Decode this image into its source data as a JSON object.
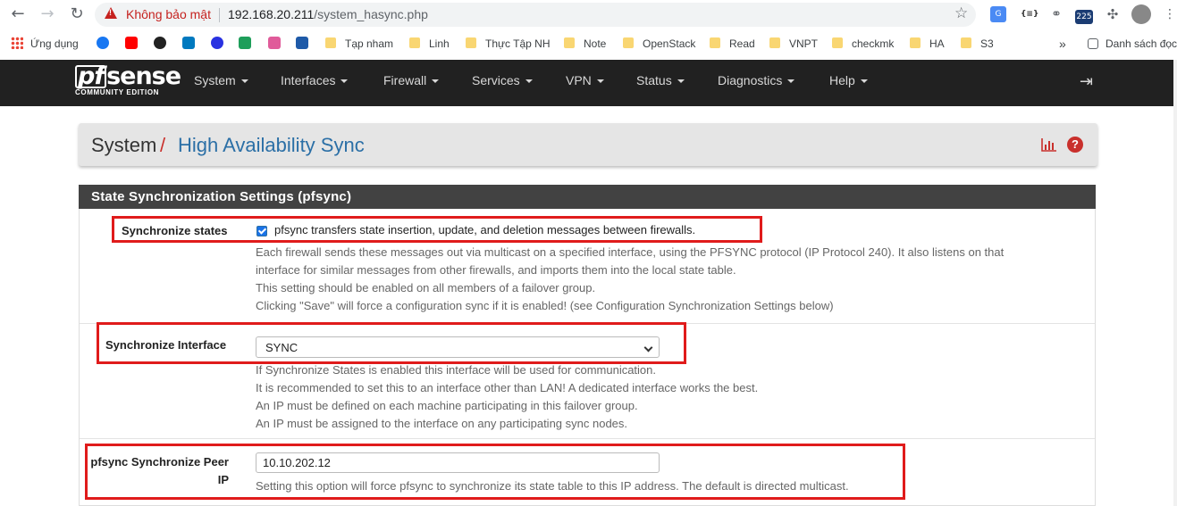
{
  "browser": {
    "security_label": "Không bảo mật",
    "url_host": "192.168.20.211",
    "url_path": "/system_hasync.php",
    "bookmarks": [
      {
        "label": "Ứng dụng"
      },
      {
        "label": "Tạp nham"
      },
      {
        "label": "Linh"
      },
      {
        "label": "Thực Tập NH"
      },
      {
        "label": "Note"
      },
      {
        "label": "OpenStack"
      },
      {
        "label": "Read"
      },
      {
        "label": "VNPT"
      },
      {
        "label": "checkmk"
      },
      {
        "label": "HA"
      },
      {
        "label": "S3"
      }
    ],
    "overflow": "»",
    "reading_list": "Danh sách đọc",
    "ext_badge": "225"
  },
  "logo": {
    "pf": "pf",
    "sense": "sense",
    "edition": "COMMUNITY EDITION"
  },
  "nav": {
    "items": [
      {
        "label": "System"
      },
      {
        "label": "Interfaces"
      },
      {
        "label": "Firewall"
      },
      {
        "label": "Services"
      },
      {
        "label": "VPN"
      },
      {
        "label": "Status"
      },
      {
        "label": "Diagnostics"
      },
      {
        "label": "Help"
      }
    ]
  },
  "breadcrumb": {
    "parent": "System",
    "separator": "/",
    "current": "High Availability Sync",
    "help": "?"
  },
  "panel": {
    "title": "State Synchronization Settings (pfsync)"
  },
  "sync_states": {
    "label": "Synchronize states",
    "checked": true,
    "checkbox_text": "pfsync transfers state insertion, update, and deletion messages between firewalls.",
    "help": [
      "Each firewall sends these messages out via multicast on a specified interface, using the PFSYNC protocol (IP Protocol 240). It also listens on that",
      "interface for similar messages from other firewalls, and imports them into the local state table.",
      "This setting should be enabled on all members of a failover group.",
      "Clicking \"Save\" will force a configuration sync if it is enabled! (see Configuration Synchronization Settings below)"
    ]
  },
  "sync_interface": {
    "label": "Synchronize Interface",
    "value": "SYNC",
    "help": [
      "If Synchronize States is enabled this interface will be used for communication.",
      "It is recommended to set this to an interface other than LAN! A dedicated interface works the best.",
      "An IP must be defined on each machine participating in this failover group.",
      "An IP must be assigned to the interface on any participating sync nodes."
    ]
  },
  "peer_ip": {
    "label_line1": "pfsync Synchronize Peer",
    "label_line2": "IP",
    "value": "10.10.202.12",
    "help": "Setting this option will force pfsync to synchronize its state table to this IP address. The default is directed multicast."
  },
  "colors": {
    "navbar": "#212121",
    "panel_head": "#424242",
    "link": "#2b6fa6",
    "accent_red": "#c9302c",
    "highlight": "#e01b1b"
  }
}
